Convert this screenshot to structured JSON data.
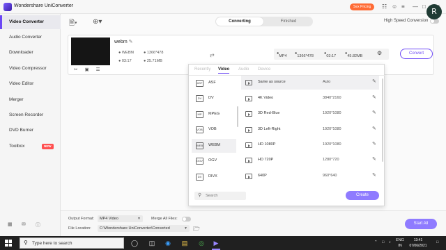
{
  "app": {
    "title": "Wondershare UniConverter",
    "sale_label": "Sex Pricing",
    "avatar_letter": "R"
  },
  "sidebar": {
    "items": [
      {
        "label": "Video Converter",
        "active": true
      },
      {
        "label": "Audio Converter"
      },
      {
        "label": "Downloader"
      },
      {
        "label": "Video Compressor"
      },
      {
        "label": "Video Editor"
      },
      {
        "label": "Merger"
      },
      {
        "label": "Screen Recorder"
      },
      {
        "label": "DVD Burner"
      },
      {
        "label": "Toolbox",
        "badge": "NEW"
      }
    ]
  },
  "tabs": {
    "converting": "Converting",
    "finished": "Finished"
  },
  "high_speed": {
    "label": "High Speed Conversion",
    "enabled": false
  },
  "file": {
    "name": "webm",
    "format": "WEBM",
    "resolution": "1366*478",
    "duration": "03:17",
    "size": "25.71MB",
    "output_format": "MP4",
    "output_resolution": "1366*478",
    "output_duration": "03:17",
    "output_size": "45.82MB",
    "convert_label": "Convert"
  },
  "format_dropdown": {
    "tabs": [
      "Recently",
      "Video",
      "Audio",
      "Device"
    ],
    "active_tab": "Video",
    "formats": [
      {
        "label": "ASF",
        "icon": "ASF"
      },
      {
        "label": "DV",
        "icon": "DV"
      },
      {
        "label": "MPEG",
        "icon": "MP"
      },
      {
        "label": "VOB",
        "icon": "VOB"
      },
      {
        "label": "WEBM",
        "icon": "WEB",
        "selected": true
      },
      {
        "label": "OGV",
        "icon": "OGV"
      },
      {
        "label": "DIVX",
        "icon": "DX"
      }
    ],
    "resolutions": [
      {
        "name": "Same as source",
        "size": "Auto",
        "selected": true
      },
      {
        "name": "4K Video",
        "size": "3840*2160"
      },
      {
        "name": "3D Red-Blue",
        "size": "1920*1080"
      },
      {
        "name": "3D Left-Right",
        "size": "1920*1080"
      },
      {
        "name": "HD 1080P",
        "size": "1920*1080"
      },
      {
        "name": "HD 720P",
        "size": "1280*720"
      },
      {
        "name": "640P",
        "size": "960*640"
      }
    ],
    "search_placeholder": "Search",
    "create_label": "Create"
  },
  "bottom": {
    "output_format_label": "Output Format:",
    "output_format_value": "MP4 Video",
    "merge_label": "Merge All Files:",
    "file_location_label": "File Location:",
    "file_location_value": "C:\\Wondershare UniConverter\\Converted",
    "start_all_label": "Start All"
  },
  "taskbar": {
    "search_text": "Type here to search",
    "lang_line1": "ENG",
    "lang_line2": "IN",
    "time": "13:41",
    "date": "07/06/2021"
  },
  "colors": {
    "accent": "#6b47f5",
    "accent_light": "#8f7bff",
    "sale": "#ff6b35",
    "new_badge": "#ff4f4f"
  }
}
